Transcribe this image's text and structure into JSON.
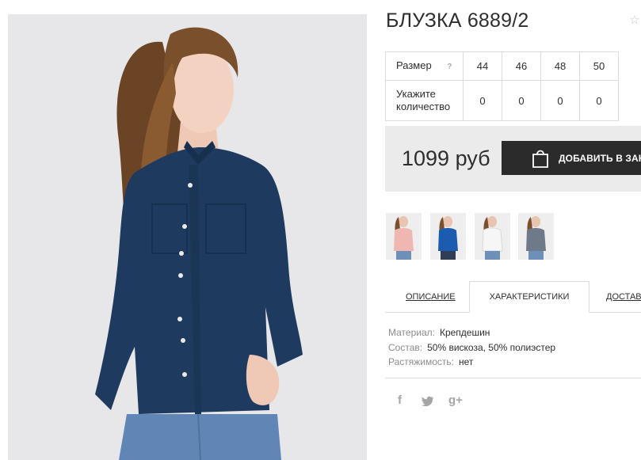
{
  "product": {
    "title": "БЛУЗКА 6889/2",
    "favorite_icon": "star-outline-icon",
    "image_alt_icon": "product-photo-woman-navy-blouse"
  },
  "size_table": {
    "size_label": "Размер",
    "help_label": "?",
    "sizes": [
      "44",
      "46",
      "48",
      "50"
    ],
    "quantity_label_line1": "Укажите",
    "quantity_label_line2": "количество",
    "quantities": [
      "0",
      "0",
      "0",
      "0"
    ]
  },
  "buy": {
    "price": "1099 руб",
    "add_button_label": "ДОБАВИТЬ В ЗАКАЗ",
    "add_button_icon": "shopping-bag-icon"
  },
  "color_variants": [
    {
      "name": "pink",
      "color": "#f0b6b2"
    },
    {
      "name": "blue",
      "color": "#1b5bb0"
    },
    {
      "name": "white",
      "color": "#f6f6f6"
    },
    {
      "name": "grey",
      "color": "#6f7a88"
    }
  ],
  "tabs": [
    {
      "label": "ОПИСАНИЕ",
      "active": false
    },
    {
      "label": "ХАРАКТЕРИСТИКИ",
      "active": true
    },
    {
      "label": "ДОСТАВКА",
      "active": false
    }
  ],
  "specs": [
    {
      "key": "Материал:",
      "value": "Крепдешин"
    },
    {
      "key": "Состав:",
      "value": "50% вискоза, 50% полиэстер"
    },
    {
      "key": "Растяжимость:",
      "value": "нет"
    }
  ],
  "social": {
    "facebook": "f",
    "twitter": "twitter-icon",
    "googleplus": "g+"
  },
  "colors": {
    "blouse_navy": "#1f3a5f",
    "button_dark": "#2b2b2b",
    "buybox_bg": "#ebebeb"
  }
}
